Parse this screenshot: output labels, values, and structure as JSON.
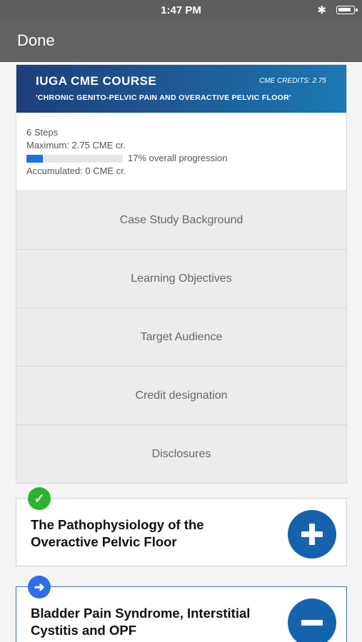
{
  "status_bar": {
    "time": "1:47 PM",
    "bluetooth_icon": "bluetooth-icon",
    "battery_icon": "battery-icon"
  },
  "nav": {
    "done_label": "Done"
  },
  "course": {
    "title": "IUGA CME COURSE",
    "credits": "CME CREDITS: 2.75",
    "subtitle": "'CHRONIC GENITO-PELVIC PAIN AND OVERACTIVE PELVIC FLOOR'",
    "steps": "6 Steps",
    "maximum": "Maximum: 2.75 CME cr.",
    "progress_fraction": 0.17,
    "progress_label": "17% overall progression",
    "accumulated": "Accumulated: 0 CME cr.",
    "colors": {
      "banner_start": "#1d3f7a",
      "banner_end": "#1b79b2",
      "progress": "#1d6fe8"
    }
  },
  "menu": [
    {
      "label": "Case Study Background"
    },
    {
      "label": "Learning Objectives"
    },
    {
      "label": "Target Audience"
    },
    {
      "label": "Credit designation"
    },
    {
      "label": "Disclosures"
    }
  ],
  "modules": [
    {
      "title": "The Pathophysiology of the Overactive Pelvic Floor",
      "status_icon": "check-icon",
      "action_icon": "plus-icon"
    },
    {
      "title": "Bladder Pain Syndrome, Interstitial Cystitis and OPF",
      "status_icon": "arrow-right-icon",
      "action_icon": "minus-icon"
    }
  ]
}
